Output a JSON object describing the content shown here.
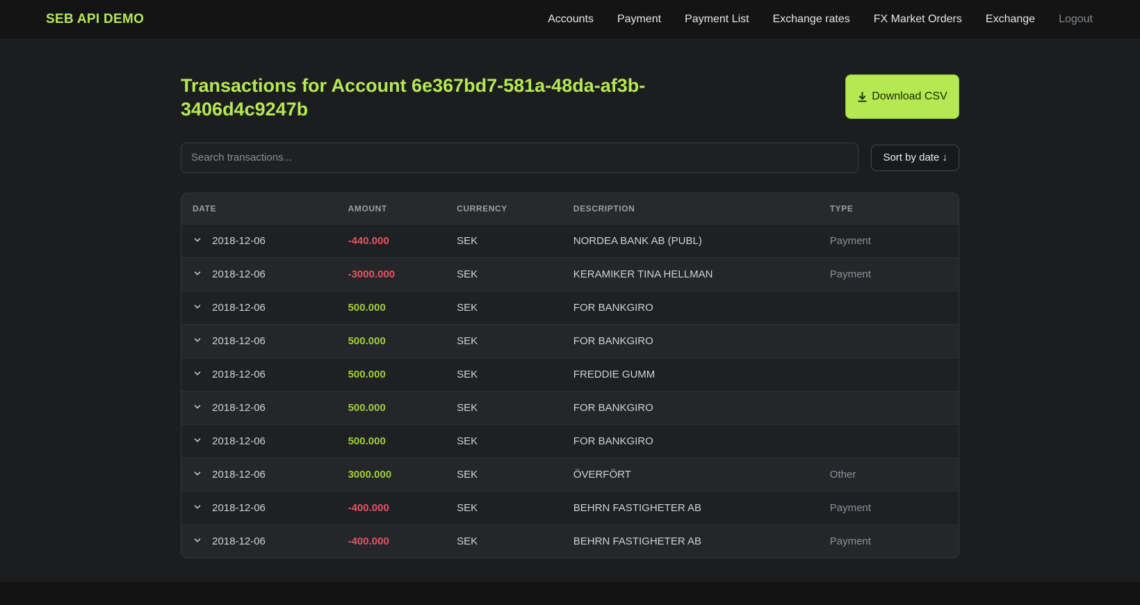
{
  "brand": "SEB API DEMO",
  "nav": {
    "items": [
      "Accounts",
      "Payment",
      "Payment List",
      "Exchange rates",
      "FX Market Orders",
      "Exchange"
    ],
    "logout": "Logout"
  },
  "page": {
    "title": "Transactions for Account 6e367bd7-581a-48da-af3b-3406d4c9247b",
    "download_button": "Download CSV",
    "search_placeholder": "Search transactions...",
    "sort_button": "Sort by date ↓"
  },
  "icons": {
    "download": "arrow-down-icon",
    "sort": "arrow-down",
    "row_expander": "chevron-down-icon"
  },
  "colors": {
    "accent": "#b5e853",
    "negative_amount": "#e25563",
    "positive_amount": "#9fce3a",
    "nav_muted": "#85898d"
  },
  "table": {
    "headers": [
      "DATE",
      "AMOUNT",
      "CURRENCY",
      "DESCRIPTION",
      "TYPE"
    ],
    "rows": [
      {
        "date": "2018-12-06",
        "amount": "-440.000",
        "currency": "SEK",
        "description": "NORDEA BANK AB (PUBL)",
        "type": "Payment"
      },
      {
        "date": "2018-12-06",
        "amount": "-3000.000",
        "currency": "SEK",
        "description": "KERAMIKER TINA HELLMAN",
        "type": "Payment"
      },
      {
        "date": "2018-12-06",
        "amount": "500.000",
        "currency": "SEK",
        "description": "FOR BANKGIRO",
        "type": ""
      },
      {
        "date": "2018-12-06",
        "amount": "500.000",
        "currency": "SEK",
        "description": "FOR BANKGIRO",
        "type": ""
      },
      {
        "date": "2018-12-06",
        "amount": "500.000",
        "currency": "SEK",
        "description": "FREDDIE GUMM",
        "type": ""
      },
      {
        "date": "2018-12-06",
        "amount": "500.000",
        "currency": "SEK",
        "description": "FOR BANKGIRO",
        "type": ""
      },
      {
        "date": "2018-12-06",
        "amount": "500.000",
        "currency": "SEK",
        "description": "FOR BANKGIRO",
        "type": ""
      },
      {
        "date": "2018-12-06",
        "amount": "3000.000",
        "currency": "SEK",
        "description": "ÖVERFÖRT",
        "type": "Other"
      },
      {
        "date": "2018-12-06",
        "amount": "-400.000",
        "currency": "SEK",
        "description": "BEHRN FASTIGHETER AB",
        "type": "Payment"
      },
      {
        "date": "2018-12-06",
        "amount": "-400.000",
        "currency": "SEK",
        "description": "BEHRN FASTIGHETER AB",
        "type": "Payment"
      }
    ]
  }
}
